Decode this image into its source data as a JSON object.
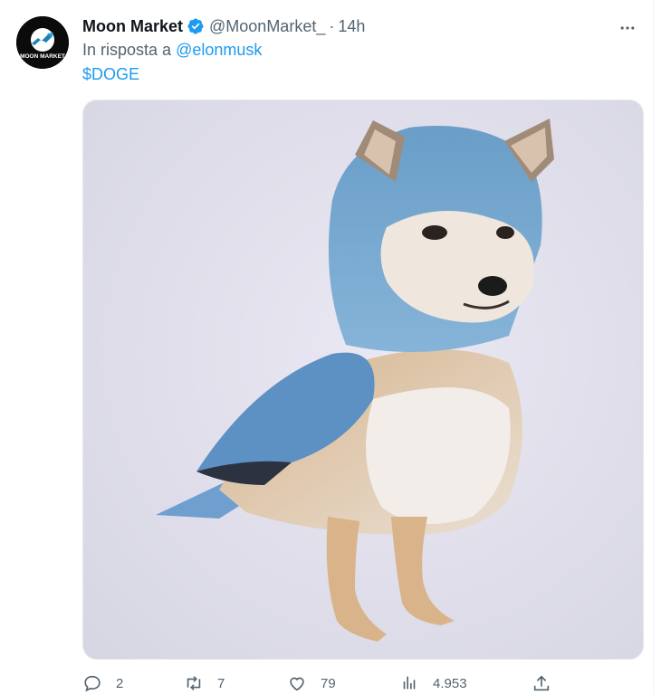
{
  "tweet": {
    "author": {
      "display_name": "Moon Market",
      "handle": "@MoonMarket_",
      "avatar_text": "MOON MARKET",
      "verified_icon": "verified-badge-icon"
    },
    "separator": "·",
    "time": "14h",
    "reply_prefix": "In risposta a",
    "reply_to": "@elonmusk",
    "text": "$DOGE",
    "media": {
      "description_icon": "doge-bird-image"
    },
    "actions": {
      "reply_count": "2",
      "retweet_count": "7",
      "like_count": "79",
      "views_count": "4.953"
    }
  },
  "colors": {
    "link": "#1d9bf0",
    "secondary_text": "#536471",
    "primary_text": "#0f1419",
    "verified": "#1d9bf0"
  }
}
